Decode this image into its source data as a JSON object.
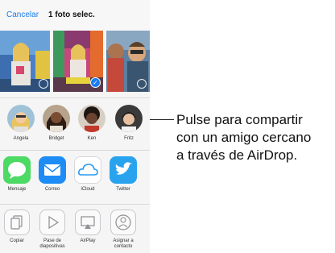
{
  "header": {
    "cancel_label": "Cancelar",
    "title": "1 foto selec."
  },
  "airdrop": {
    "people": [
      {
        "name": "Angela"
      },
      {
        "name": "Bridget"
      },
      {
        "name": "Ken"
      },
      {
        "name": "Fritz"
      }
    ]
  },
  "apps": [
    {
      "label": "Mensaje",
      "icon": "message-bubble-icon",
      "color": "#4cd964"
    },
    {
      "label": "Correo",
      "icon": "envelope-icon",
      "color": "#1e8cf5"
    },
    {
      "label": "iCloud",
      "icon": "cloud-icon",
      "color": "#2f9bf0"
    },
    {
      "label": "Twitter",
      "icon": "twitter-bird-icon",
      "color": "#2aa3ef"
    }
  ],
  "actions": [
    {
      "label_line1": "Copiar",
      "label_line2": "",
      "icon": "copy-icon"
    },
    {
      "label_line1": "Pase de",
      "label_line2": "diapositivas",
      "icon": "play-icon"
    },
    {
      "label_line1": "AirPlay",
      "label_line2": "",
      "icon": "airplay-icon"
    },
    {
      "label_line1": "Asignar a",
      "label_line2": "contacto",
      "icon": "contact-icon"
    }
  ],
  "callout": {
    "line1": "Pulse para compartir",
    "line2": "con un amigo cercano",
    "line3": "a través de AirDrop."
  }
}
